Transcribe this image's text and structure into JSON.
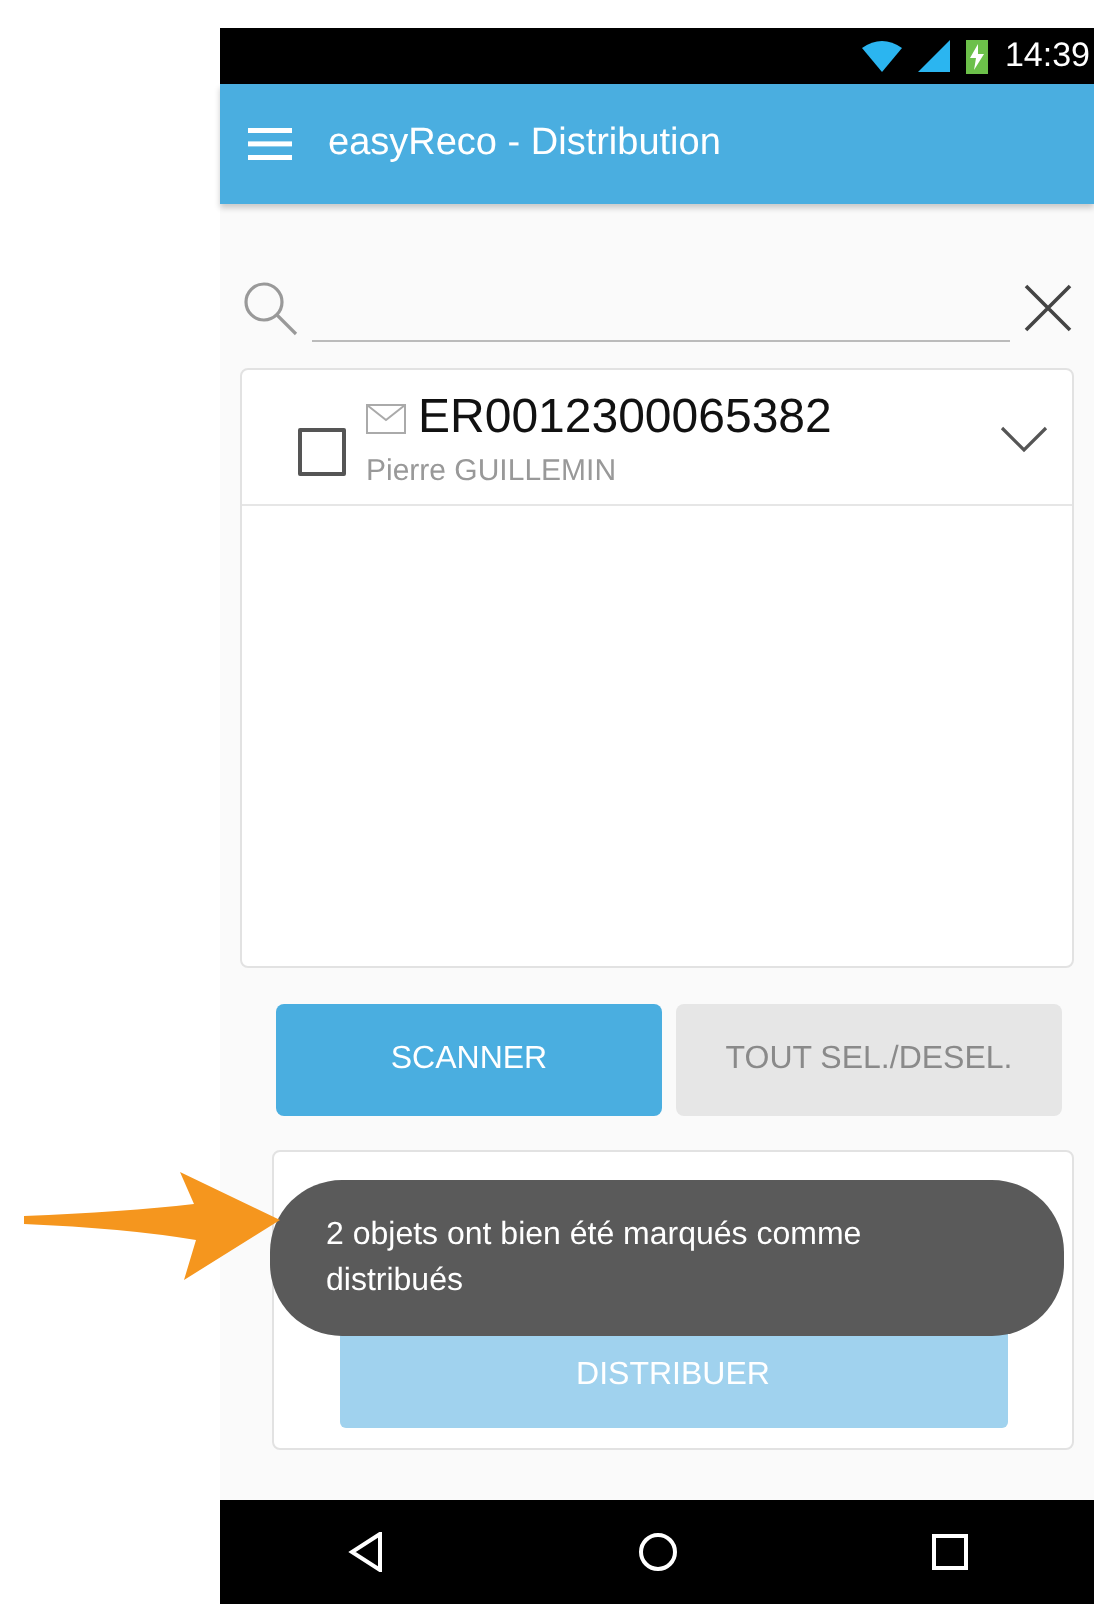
{
  "status_bar": {
    "time": "14:39"
  },
  "app_bar": {
    "title": "easyReco - Distribution"
  },
  "items": [
    {
      "code": "ER0012300065382",
      "name": "Pierre GUILLEMIN",
      "checked": false,
      "expanded": false
    }
  ],
  "buttons": [
    {
      "label": "SCANNER",
      "disabled": false
    },
    {
      "label": "TOUT SEL./DESEL.",
      "disabled": true
    }
  ],
  "distribute_button": {
    "label": "DISTRIBUER",
    "disabled": true
  },
  "toast": {
    "message": "2 objets ont bien été marqués comme distribués"
  }
}
